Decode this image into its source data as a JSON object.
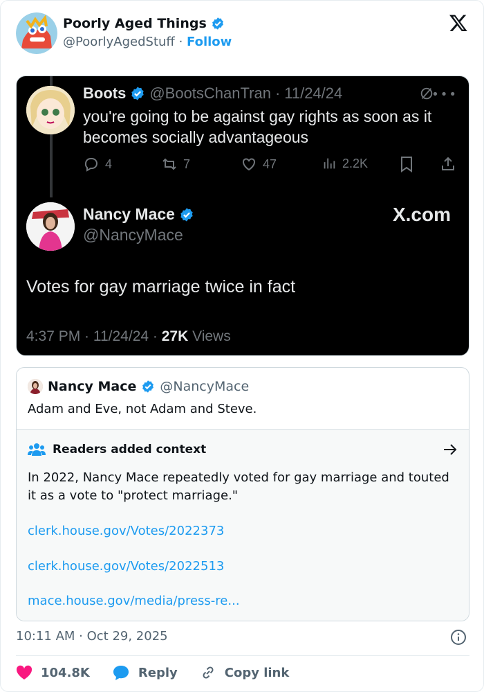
{
  "header": {
    "name": "Poorly Aged Things",
    "handle": "@PoorlyAgedStuff",
    "separator": "·",
    "follow_label": "Follow"
  },
  "screenshot": {
    "reply_author": {
      "name": "Boots",
      "handle": "@BootsChanTran",
      "date": "11/24/24",
      "text": "you're going to be against gay rights as soon as it becomes socially advantageous",
      "replies": "4",
      "reposts": "7",
      "likes": "47",
      "views": "2.2K"
    },
    "main": {
      "name": "Nancy Mace",
      "handle": "@NancyMace",
      "brand": "X.com",
      "text": "Votes for gay marriage twice in fact",
      "meta_prefix": "4:37 PM · 11/24/24 · ",
      "views_count": "27K",
      "views_label": " Views"
    }
  },
  "quote": {
    "name": "Nancy Mace",
    "handle": "@NancyMace",
    "text": "Adam and Eve, not Adam and Steve.",
    "notes": {
      "title": "Readers added context",
      "body": "In 2022, Nancy Mace repeatedly voted for gay marriage and touted it as a vote to \"protect marriage.\"",
      "links": [
        "clerk.house.gov/Votes/2022373",
        "clerk.house.gov/Votes/2022513",
        "mace.house.gov/media/press-re..."
      ]
    }
  },
  "footer": {
    "timestamp": "10:11 AM · Oct 29, 2025",
    "likes": "104.8K",
    "reply_label": "Reply",
    "copy_label": "Copy link"
  },
  "colors": {
    "accent": "#1d9bf0",
    "like": "#f91880",
    "text_secondary": "#536471"
  }
}
